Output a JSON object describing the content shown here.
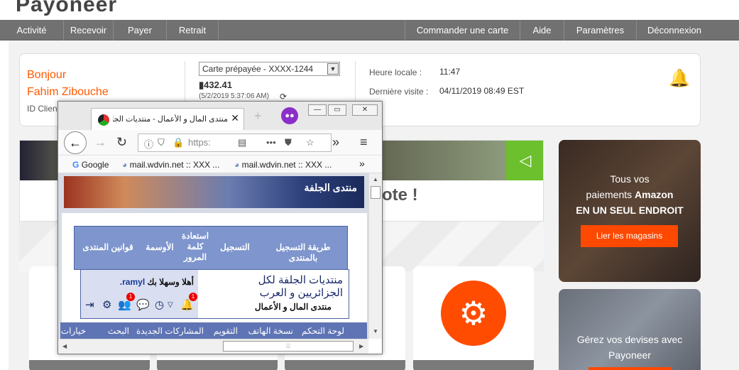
{
  "logo": {
    "visible_fragment": "Payoneer"
  },
  "nav": {
    "left": [
      "Activité",
      "Recevoir",
      "Payer",
      "Retrait"
    ],
    "right": [
      "Commander une carte",
      "Aide",
      "Paramètres",
      "Déconnexion"
    ]
  },
  "account": {
    "greeting": "Bonjour",
    "name": "Fahim Zibouche",
    "id_label": "ID Clien",
    "card_select": "Carte prépayée - XXXX-1244",
    "balance": "432.41",
    "balance_time": "(5/2/2019 5:37:06 AM)",
    "local_time_label": "Heure locale :",
    "local_time": "11:47",
    "last_visit_label": "Dernière visite :",
    "last_visit": "04/11/2019 08:49 EST"
  },
  "hero": {
    "text_fragment": "ote !"
  },
  "promo": {
    "amazon_line1": "Tous vos",
    "amazon_line2_pre": "paiements",
    "amazon_line2_bold": "Amazon",
    "amazon_line3": "EN UN SEUL ENDROIT",
    "amazon_button": "Lier les magasins",
    "currency_line1": "Gérez vos devises avec",
    "currency_line2": "Payoneer"
  },
  "browser": {
    "tab_title": "منتدى المال و الأعمال - منتديات الجلفة",
    "url_fragment": "https:",
    "bookmarks": [
      "Google",
      "mail.wdvin.net :: XXX ...",
      "mail.wdvin.net :: XXX ..."
    ],
    "forum": {
      "menu": [
        "طريقة التسجيل بالمنتدى",
        "التسجيل",
        "استعادة كلمة المرور",
        "الأوسمة",
        "قوانين المنتدى"
      ],
      "welcome_pre": "أهلا وسهلا بك",
      "username": "ramyl.",
      "forum_name_line1": "منتديات الجلفة لكل",
      "forum_name_line2": "الجزائريين و العرب",
      "sub_forum": "منتدى المال و الأعمال",
      "notif_count_1": "1",
      "notif_count_2": "1",
      "bottom_nav": [
        "لوحة التحكم",
        "نسخة الهاتف",
        "التقويم",
        "المشاركات الجديدة",
        "البحث",
        "خيارات"
      ]
    }
  },
  "colors": {
    "brand_orange": "#ff4800",
    "nav_gray": "#717171",
    "forum_blue": "#7e95cd",
    "hero_green": "#6cbf2d"
  }
}
